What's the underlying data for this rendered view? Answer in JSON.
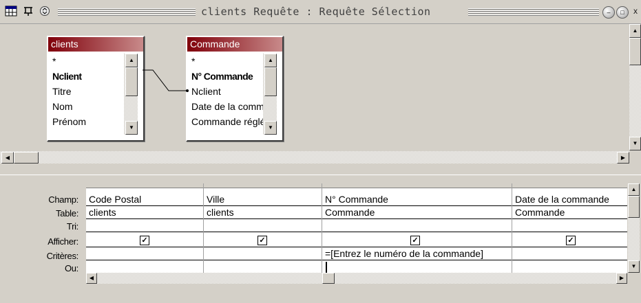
{
  "window": {
    "title": "clients Requête : Requête Sélection"
  },
  "tables": [
    {
      "name": "clients",
      "fields": [
        "*",
        "Nclient",
        "Titre",
        "Nom",
        "Prénom"
      ],
      "key_field": "Nclient"
    },
    {
      "name": "Commande",
      "fields": [
        "*",
        "N° Commande",
        "Nclient",
        "Date de la commande",
        "Commande réglée"
      ],
      "key_field": "N° Commande"
    }
  ],
  "grid": {
    "row_labels": [
      "Champ:",
      "Table:",
      "Tri:",
      "Afficher:",
      "Critères:",
      "Ou:"
    ],
    "columns": [
      {
        "field": "Code Postal",
        "table": "clients",
        "sort": "",
        "show": true,
        "criteria": "",
        "or": ""
      },
      {
        "field": "Ville",
        "table": "clients",
        "sort": "",
        "show": true,
        "criteria": "",
        "or": ""
      },
      {
        "field": "N° Commande",
        "table": "Commande",
        "sort": "",
        "show": true,
        "criteria": "=[Entrez le numéro de la commande]",
        "or": ""
      },
      {
        "field": "Date de la commande",
        "table": "Commande",
        "sort": "",
        "show": true,
        "criteria": "",
        "or": ""
      }
    ]
  },
  "icons": {
    "window_icon": "query-design-icon",
    "pin": "pin-icon",
    "menu": "window-menu-icon",
    "minimize": "minimize-icon",
    "maximize": "maximize-icon",
    "close": "close-icon"
  }
}
